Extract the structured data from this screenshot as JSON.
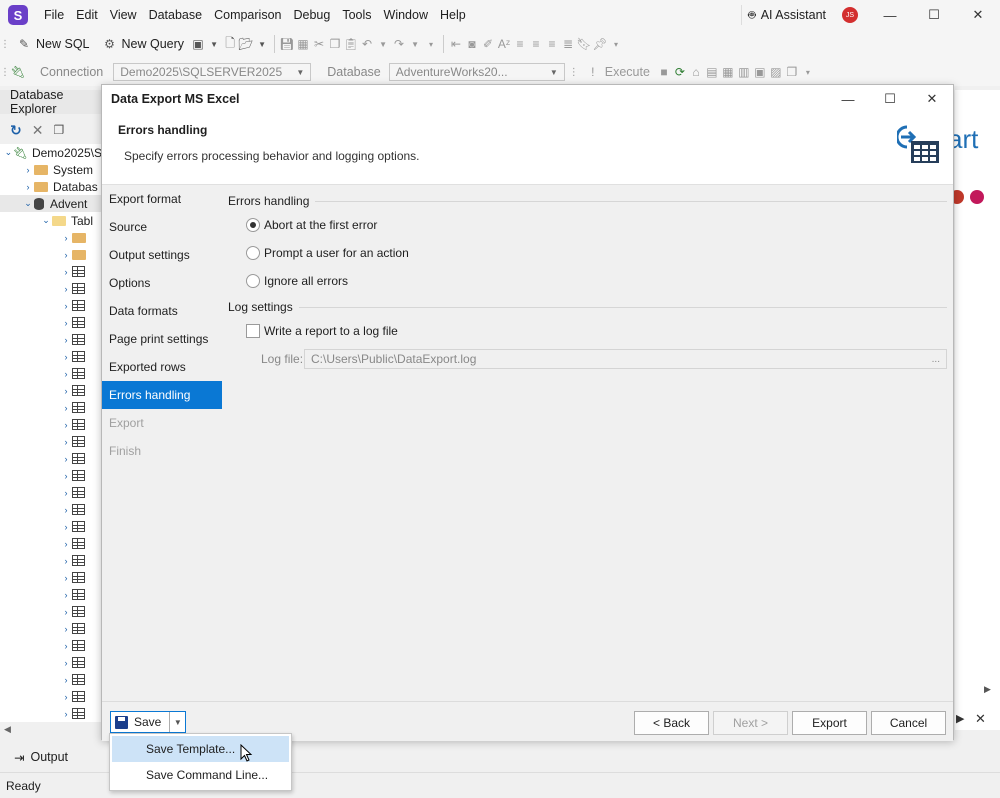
{
  "app": {
    "logo_letter": "S",
    "menu": [
      "File",
      "Edit",
      "View",
      "Database",
      "Comparison",
      "Debug",
      "Tools",
      "Window",
      "Help"
    ],
    "ai_assistant": "AI Assistant",
    "user_initials": "JS",
    "window_controls": {
      "minimize": "—",
      "maximize": "☐",
      "close": "✕"
    }
  },
  "toolbar1": {
    "new_sql": "New SQL",
    "new_query": "New Query"
  },
  "toolbar2": {
    "connection_label": "Connection",
    "connection_value": "Demo2025\\SQLSERVER2025",
    "database_label": "Database",
    "database_value": "AdventureWorks20...",
    "execute": "Execute"
  },
  "explorer": {
    "title": "Database Explorer",
    "tree": [
      {
        "label": "Demo2025\\S",
        "level": 0,
        "icon": "server-icon",
        "expanded": true
      },
      {
        "label": "System",
        "level": 1,
        "icon": "folder-icon",
        "expanded": false
      },
      {
        "label": "Databas",
        "level": 1,
        "icon": "folder-icon",
        "expanded": false
      },
      {
        "label": "Advent",
        "level": 1,
        "icon": "database-icon",
        "expanded": true
      },
      {
        "label": "Tabl",
        "level": 2,
        "icon": "folder-open-icon",
        "expanded": true
      }
    ],
    "bottom_tab": "Output"
  },
  "status": {
    "text": "Ready"
  },
  "right_panel": {
    "brand_fragment": "art"
  },
  "dialog": {
    "title": "Data Export MS Excel",
    "header_title": "Errors handling",
    "header_desc": "Specify errors processing behavior and logging options.",
    "nav": [
      {
        "label": "Export format",
        "state": "normal"
      },
      {
        "label": "Source",
        "state": "normal"
      },
      {
        "label": "Output settings",
        "state": "normal"
      },
      {
        "label": "Options",
        "state": "normal"
      },
      {
        "label": "Data formats",
        "state": "normal"
      },
      {
        "label": "Page print settings",
        "state": "normal"
      },
      {
        "label": "Exported rows",
        "state": "normal"
      },
      {
        "label": "Errors handling",
        "state": "active"
      },
      {
        "label": "Export",
        "state": "disabled"
      },
      {
        "label": "Finish",
        "state": "disabled"
      }
    ],
    "errors_group": "Errors handling",
    "options": [
      {
        "label": "Abort at the first error",
        "checked": true
      },
      {
        "label": "Prompt a user for an action",
        "checked": false
      },
      {
        "label": "Ignore all errors",
        "checked": false
      }
    ],
    "log_group": "Log settings",
    "write_report": "Write a report to a log file",
    "write_report_checked": false,
    "log_file_label": "Log file:",
    "log_file_value": "C:\\Users\\Public\\DataExport.log",
    "browse": "...",
    "footer": {
      "save": "Save",
      "back": "< Back",
      "next": "Next >",
      "export": "Export",
      "cancel": "Cancel"
    },
    "save_menu": [
      "Save Template...",
      "Save Command Line..."
    ]
  }
}
